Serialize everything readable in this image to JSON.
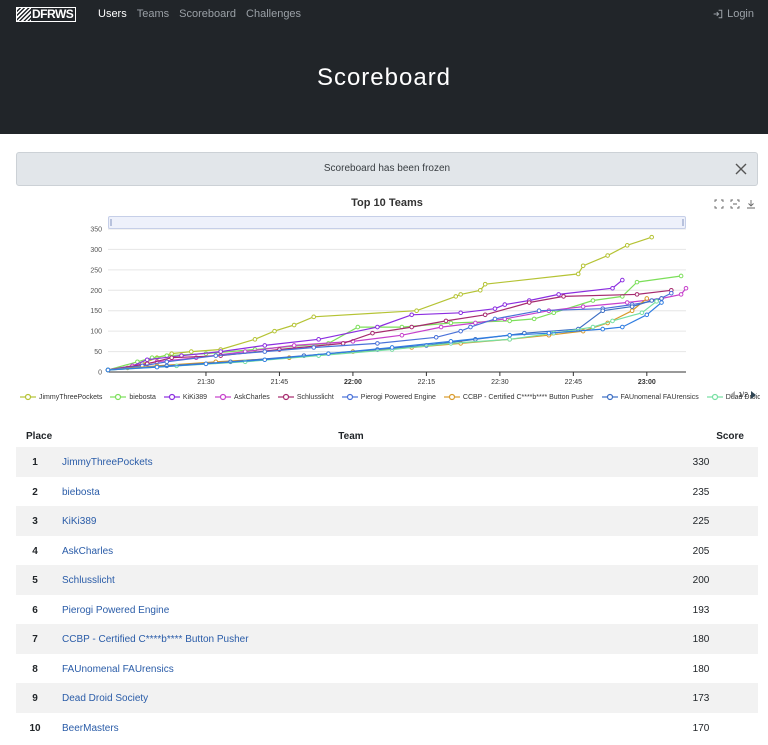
{
  "brand": {
    "text": "DFRWS"
  },
  "nav": [
    {
      "label": "Users",
      "active": true
    },
    {
      "label": "Teams",
      "active": false
    },
    {
      "label": "Scoreboard",
      "active": false
    },
    {
      "label": "Challenges",
      "active": false
    }
  ],
  "login_label": "Login",
  "page_title": "Scoreboard",
  "alert": {
    "text": "Scoreboard has been frozen"
  },
  "toolbox": [
    "zoom-icon",
    "zoom-reset-icon",
    "download-icon"
  ],
  "legend_page": "1/2",
  "chart_data": {
    "type": "line",
    "title": "Top 10 Teams",
    "ylim": [
      0,
      350
    ],
    "yticks": [
      "0",
      "50",
      "100",
      "150",
      "200",
      "250",
      "300",
      "350"
    ],
    "xlim": [
      "21:10",
      "23:08"
    ],
    "xticks": [
      {
        "time": "21:30",
        "label": "21:30",
        "bold": false
      },
      {
        "time": "21:45",
        "label": "21:45",
        "bold": false
      },
      {
        "time": "22:00",
        "label": "22:00",
        "bold": true
      },
      {
        "time": "22:15",
        "label": "22:15",
        "bold": false
      },
      {
        "time": "22:30",
        "label": "22:30",
        "bold": false
      },
      {
        "time": "22:45",
        "label": "22:45",
        "bold": false
      },
      {
        "time": "23:00",
        "label": "23:00",
        "bold": true
      }
    ],
    "grid": true,
    "legend_position": "bottom",
    "series": [
      {
        "name": "JimmyThreePockets",
        "color": "#b5c334",
        "points": [
          [
            "21:10",
            5
          ],
          [
            "21:14",
            10
          ],
          [
            "21:17",
            20
          ],
          [
            "21:20",
            35
          ],
          [
            "21:23",
            45
          ],
          [
            "21:27",
            50
          ],
          [
            "21:33",
            55
          ],
          [
            "21:40",
            80
          ],
          [
            "21:44",
            100
          ],
          [
            "21:48",
            115
          ],
          [
            "21:52",
            135
          ],
          [
            "22:13",
            150
          ],
          [
            "22:21",
            185
          ],
          [
            "22:22",
            190
          ],
          [
            "22:26",
            200
          ],
          [
            "22:27",
            215
          ],
          [
            "22:46",
            240
          ],
          [
            "22:47",
            260
          ],
          [
            "22:52",
            285
          ],
          [
            "22:56",
            310
          ],
          [
            "23:01",
            330
          ]
        ]
      },
      {
        "name": "biebosta",
        "color": "#7cdf5a",
        "points": [
          [
            "21:10",
            5
          ],
          [
            "21:16",
            25
          ],
          [
            "21:19",
            35
          ],
          [
            "21:22",
            40
          ],
          [
            "21:30",
            45
          ],
          [
            "21:40",
            55
          ],
          [
            "21:55",
            70
          ],
          [
            "22:01",
            110
          ],
          [
            "22:10",
            110
          ],
          [
            "22:20",
            120
          ],
          [
            "22:32",
            125
          ],
          [
            "22:37",
            130
          ],
          [
            "22:41",
            145
          ],
          [
            "22:49",
            175
          ],
          [
            "22:55",
            185
          ],
          [
            "22:58",
            220
          ],
          [
            "23:07",
            235
          ]
        ]
      },
      {
        "name": "KiKi389",
        "color": "#8b2de0",
        "points": [
          [
            "21:10",
            5
          ],
          [
            "21:15",
            15
          ],
          [
            "21:18",
            30
          ],
          [
            "21:25",
            40
          ],
          [
            "21:33",
            50
          ],
          [
            "21:42",
            65
          ],
          [
            "21:53",
            80
          ],
          [
            "22:05",
            110
          ],
          [
            "22:12",
            140
          ],
          [
            "22:22",
            145
          ],
          [
            "22:29",
            155
          ],
          [
            "22:31",
            165
          ],
          [
            "22:36",
            175
          ],
          [
            "22:42",
            190
          ],
          [
            "22:53",
            205
          ],
          [
            "22:55",
            225
          ]
        ]
      },
      {
        "name": "AskCharles",
        "color": "#c640cc",
        "points": [
          [
            "21:10",
            5
          ],
          [
            "21:15",
            15
          ],
          [
            "21:20",
            25
          ],
          [
            "21:28",
            35
          ],
          [
            "21:38",
            50
          ],
          [
            "21:48",
            65
          ],
          [
            "22:00",
            75
          ],
          [
            "22:10",
            90
          ],
          [
            "22:18",
            110
          ],
          [
            "22:25",
            120
          ],
          [
            "22:31",
            130
          ],
          [
            "22:40",
            150
          ],
          [
            "22:47",
            160
          ],
          [
            "22:56",
            170
          ],
          [
            "23:03",
            180
          ],
          [
            "23:07",
            190
          ],
          [
            "23:08",
            205
          ]
        ]
      },
      {
        "name": "Schlusslicht",
        "color": "#a62a6e",
        "points": [
          [
            "21:10",
            5
          ],
          [
            "21:18",
            20
          ],
          [
            "21:23",
            35
          ],
          [
            "21:33",
            40
          ],
          [
            "21:45",
            55
          ],
          [
            "21:58",
            70
          ],
          [
            "22:04",
            95
          ],
          [
            "22:12",
            110
          ],
          [
            "22:19",
            125
          ],
          [
            "22:27",
            140
          ],
          [
            "22:36",
            170
          ],
          [
            "22:43",
            185
          ],
          [
            "22:58",
            190
          ],
          [
            "23:05",
            200
          ]
        ]
      },
      {
        "name": "Pierogi Powered Engine",
        "color": "#4a72d9",
        "points": [
          [
            "21:10",
            5
          ],
          [
            "21:17",
            15
          ],
          [
            "21:22",
            25
          ],
          [
            "21:32",
            40
          ],
          [
            "21:42",
            50
          ],
          [
            "21:52",
            60
          ],
          [
            "22:05",
            70
          ],
          [
            "22:17",
            85
          ],
          [
            "22:22",
            100
          ],
          [
            "22:24",
            110
          ],
          [
            "22:29",
            130
          ],
          [
            "22:38",
            150
          ],
          [
            "22:51",
            155
          ],
          [
            "22:57",
            165
          ],
          [
            "23:02",
            175
          ],
          [
            "23:05",
            193
          ]
        ]
      },
      {
        "name": "CCBP - Certified C****b**** Button Pusher",
        "color": "#d99b2c",
        "points": [
          [
            "21:10",
            5
          ],
          [
            "21:20",
            15
          ],
          [
            "21:32",
            25
          ],
          [
            "21:47",
            35
          ],
          [
            "22:00",
            50
          ],
          [
            "22:12",
            60
          ],
          [
            "22:22",
            70
          ],
          [
            "22:32",
            80
          ],
          [
            "22:40",
            90
          ],
          [
            "22:47",
            100
          ],
          [
            "22:52",
            120
          ],
          [
            "22:57",
            150
          ],
          [
            "23:00",
            180
          ]
        ]
      },
      {
        "name": "FAUnomenal FAUrensics",
        "color": "#3d6fc4",
        "points": [
          [
            "21:10",
            5
          ],
          [
            "21:22",
            15
          ],
          [
            "21:35",
            25
          ],
          [
            "21:50",
            40
          ],
          [
            "22:05",
            55
          ],
          [
            "22:15",
            65
          ],
          [
            "22:25",
            80
          ],
          [
            "22:35",
            95
          ],
          [
            "22:46",
            105
          ],
          [
            "22:51",
            150
          ],
          [
            "22:57",
            160
          ],
          [
            "23:01",
            175
          ],
          [
            "23:03",
            180
          ]
        ]
      },
      {
        "name": "Dead Droid Society",
        "color": "#76e0a2",
        "points": [
          [
            "21:10",
            5
          ],
          [
            "21:24",
            15
          ],
          [
            "21:38",
            25
          ],
          [
            "21:53",
            40
          ],
          [
            "22:08",
            55
          ],
          [
            "22:20",
            70
          ],
          [
            "22:32",
            80
          ],
          [
            "22:41",
            95
          ],
          [
            "22:49",
            110
          ],
          [
            "22:53",
            125
          ],
          [
            "22:59",
            145
          ],
          [
            "23:02",
            173
          ]
        ]
      },
      {
        "name": "BeerMasters",
        "color": "#2f7de1",
        "points": [
          [
            "21:10",
            5
          ],
          [
            "21:20",
            12
          ],
          [
            "21:30",
            20
          ],
          [
            "21:42",
            30
          ],
          [
            "21:55",
            45
          ],
          [
            "22:08",
            60
          ],
          [
            "22:20",
            75
          ],
          [
            "22:32",
            90
          ],
          [
            "22:40",
            95
          ],
          [
            "22:51",
            105
          ],
          [
            "22:55",
            110
          ],
          [
            "23:00",
            140
          ],
          [
            "23:03",
            170
          ]
        ]
      }
    ]
  },
  "table": {
    "headers": {
      "place": "Place",
      "team": "Team",
      "score": "Score"
    },
    "rows": [
      {
        "place": "1",
        "team": "JimmyThreePockets",
        "score": "330"
      },
      {
        "place": "2",
        "team": "biebosta",
        "score": "235"
      },
      {
        "place": "3",
        "team": "KiKi389",
        "score": "225"
      },
      {
        "place": "4",
        "team": "AskCharles",
        "score": "205"
      },
      {
        "place": "5",
        "team": "Schlusslicht",
        "score": "200"
      },
      {
        "place": "6",
        "team": "Pierogi Powered Engine",
        "score": "193"
      },
      {
        "place": "7",
        "team": "CCBP - Certified C****b**** Button Pusher",
        "score": "180"
      },
      {
        "place": "8",
        "team": "FAUnomenal FAUrensics",
        "score": "180"
      },
      {
        "place": "9",
        "team": "Dead Droid Society",
        "score": "173"
      },
      {
        "place": "10",
        "team": "BeerMasters",
        "score": "170"
      }
    ]
  }
}
